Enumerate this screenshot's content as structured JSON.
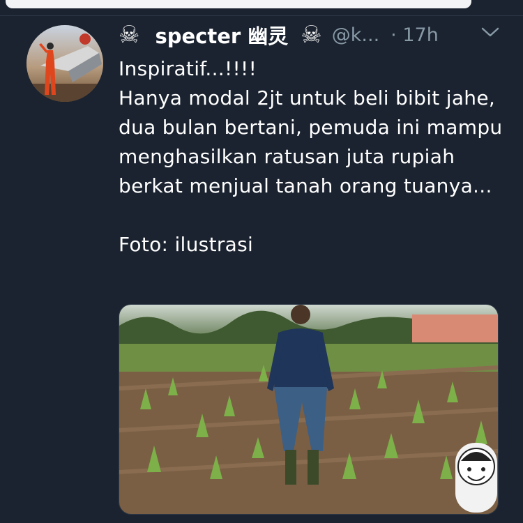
{
  "tweet": {
    "author_name": "specter 幽灵",
    "name_icon": "skull-crossbones",
    "handle": "@k...",
    "time": "· 17h",
    "text": "Inspiratif...!!!!\nHanya modal 2jt untuk beli bibit jahe, dua bulan bertani, pemuda ini mampu menghasilkan ratusan juta rupiah berkat menjual tanah orang tuanya...\n\nFoto: ilustrasi"
  },
  "colors": {
    "background": "#1b2330",
    "muted_text": "#8899a6",
    "text": "#ffffff"
  }
}
